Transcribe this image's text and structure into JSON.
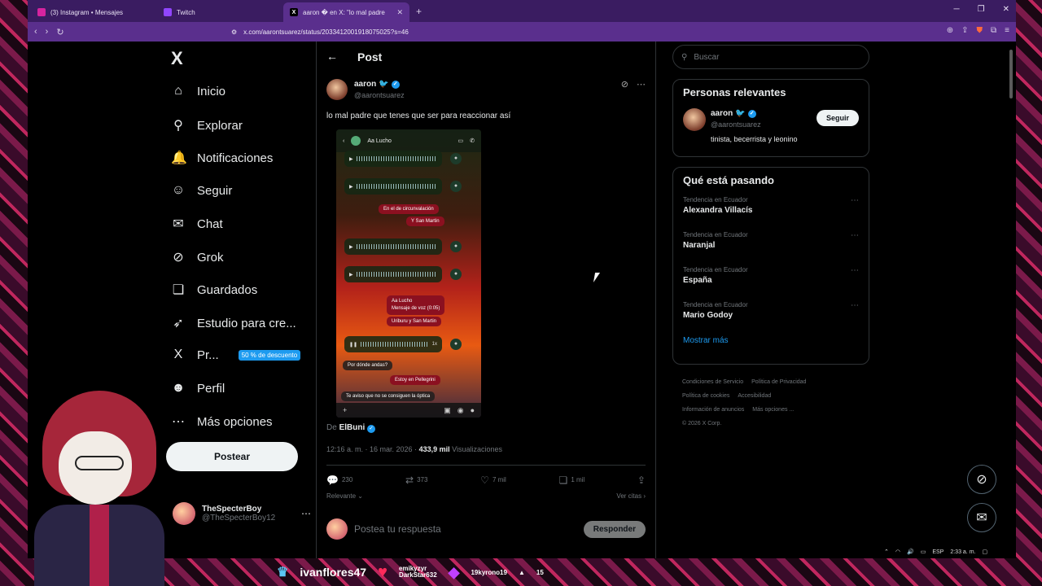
{
  "browser": {
    "tabs": [
      {
        "label": "(3) Instagram • Mensajes",
        "active": false,
        "color": "#d6249f"
      },
      {
        "label": "Twitch",
        "active": false,
        "color": "#9146ff"
      },
      {
        "label": "aaron � en X: \"lo mal padre",
        "active": true,
        "color": "#000000"
      }
    ],
    "url": "x.com/aarontsuarez/status/2033412001918075025?s=46"
  },
  "nav": {
    "logo": "X",
    "items": [
      {
        "label": "Inicio",
        "icon": "home-icon",
        "glyph": "⌂"
      },
      {
        "label": "Explorar",
        "icon": "search-icon",
        "glyph": "⚲"
      },
      {
        "label": "Notificaciones",
        "icon": "bell-icon",
        "glyph": "🔔"
      },
      {
        "label": "Seguir",
        "icon": "add-user-icon",
        "glyph": "☺"
      },
      {
        "label": "Chat",
        "icon": "mail-icon",
        "glyph": "✉"
      },
      {
        "label": "Grok",
        "icon": "grok-icon",
        "glyph": "⊘"
      },
      {
        "label": "Guardados",
        "icon": "bookmark-icon",
        "glyph": "❏"
      },
      {
        "label": "Estudio para cre...",
        "icon": "rocket-icon",
        "glyph": "➶"
      },
      {
        "label": "Pr...",
        "icon": "x-premium-icon",
        "glyph": "X"
      },
      {
        "label": "Perfil",
        "icon": "profile-icon",
        "glyph": "☻"
      },
      {
        "label": "Más opciones",
        "icon": "more-icon",
        "glyph": "⋯"
      }
    ],
    "promo": "50 % de descuento",
    "post_button": "Postear",
    "user_name": "TheSpecterBoy",
    "user_handle": "@TheSpecterBoy12"
  },
  "post": {
    "header": "Post",
    "author_name": "aaron",
    "author_handle": "@aarontsuarez",
    "text": "lo mal padre que tenes que ser para reaccionar así",
    "media": {
      "chat_name": "Aa Lucho",
      "messages": [
        "En el de circunvalación",
        "Y San Martin",
        "Aa Lucho",
        "Mensaje de voz (0:05)",
        "Uriburu y San Martin",
        "Por dónde andas?",
        "Estoy en Pellegrini",
        "Te aviso que no se consiguen la óptica"
      ],
      "speed": "1x"
    },
    "source_prefix": "De",
    "source_name": "ElBuni",
    "time": "12:16 a. m. · 16 mar. 2026 ·",
    "views": "433,9 mil",
    "views_label": "Visualizaciones",
    "stats": {
      "replies": "230",
      "reposts": "373",
      "likes": "7 mil",
      "bookmarks": "1 mil"
    },
    "sort": "Relevante",
    "quotes": "Ver citas",
    "reply_placeholder": "Postea tu respuesta",
    "reply_button": "Responder"
  },
  "sidebar": {
    "search_placeholder": "Buscar",
    "relevant_title": "Personas relevantes",
    "rel_name": "aaron",
    "rel_handle": "@aarontsuarez",
    "rel_bio": "tinista, becerrista y leonino",
    "follow_label": "Seguir",
    "trending_title": "Qué está pasando",
    "trends": [
      {
        "context": "Tendencia en Ecuador",
        "name": "Alexandra Villacís"
      },
      {
        "context": "Tendencia en Ecuador",
        "name": "Naranjal"
      },
      {
        "context": "Tendencia en Ecuador",
        "name": "España"
      },
      {
        "context": "Tendencia en Ecuador",
        "name": "Mario Godoy"
      }
    ],
    "show_more": "Mostrar más",
    "footer": [
      "Condiciones de Servicio",
      "Política de Privacidad",
      "Política de cookies",
      "Accesibilidad",
      "Información de anuncios",
      "Más opciones ...",
      "© 2026 X Corp."
    ]
  },
  "tray": {
    "lang": "ESP",
    "time": "2:33 a. m."
  },
  "overlay": {
    "name1": "ivanflores47",
    "name2a": "emikyzyr",
    "name2b": "DarkStar632",
    "name3": "19kyrono19",
    "count3": "15"
  }
}
